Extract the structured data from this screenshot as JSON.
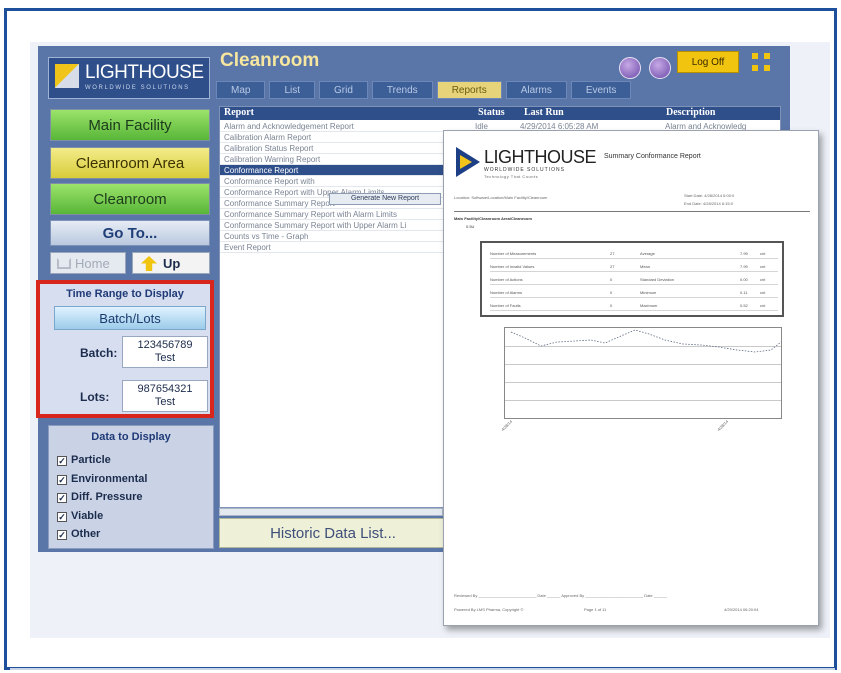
{
  "app": {
    "title": "Cleanroom",
    "logo_name": "LIGHTHOUSE",
    "logo_sub": "WORLDWIDE SOLUTIONS",
    "logoff_label": "Log Off"
  },
  "tabs": [
    {
      "label": "Map"
    },
    {
      "label": "List"
    },
    {
      "label": "Grid"
    },
    {
      "label": "Trends"
    },
    {
      "label": "Reports",
      "active": true
    },
    {
      "label": "Alarms"
    },
    {
      "label": "Events"
    }
  ],
  "nav": {
    "main_facility": "Main Facility",
    "cleanroom_area": "Cleanroom Area",
    "cleanroom": "Cleanroom",
    "goto": "Go To...",
    "home": "Home",
    "up": "Up"
  },
  "time_range": {
    "title": "Time Range to Display",
    "mode": "Batch/Lots",
    "batch_label": "Batch:",
    "batch_value_1": "123456789",
    "batch_value_2": "Test",
    "lots_label": "Lots:",
    "lots_value_1": "987654321",
    "lots_value_2": "Test"
  },
  "data_display": {
    "title": "Data to Display",
    "items": [
      {
        "label": "Particle",
        "checked": true
      },
      {
        "label": "Environmental",
        "checked": true
      },
      {
        "label": "Diff. Pressure",
        "checked": true
      },
      {
        "label": "Viable",
        "checked": true
      },
      {
        "label": "Other",
        "checked": true
      }
    ]
  },
  "report_list": {
    "headers": {
      "report": "Report",
      "status": "Status",
      "last_run": "Last Run",
      "description": "Description"
    },
    "rows": [
      {
        "name": "Alarm and Acknowledgement Report",
        "status": "Idle",
        "last_run": "4/29/2014 6:05:28 AM",
        "desc": "Alarm and Acknowledg"
      },
      {
        "name": "Calibration Alarm Report",
        "status": "",
        "last_run": "",
        "desc": ""
      },
      {
        "name": "Calibration Status Report",
        "status": "",
        "last_run": "",
        "desc": ""
      },
      {
        "name": "Calibration Warning Report",
        "status": "",
        "last_run": "",
        "desc": ""
      },
      {
        "name": "Conformance Report",
        "status": "",
        "last_run": "",
        "desc": "",
        "selected": true
      },
      {
        "name": "Conformance Report with",
        "status": "",
        "last_run": "",
        "desc": ""
      },
      {
        "name": "Conformance Report with Upper Alarm Limits",
        "status": "",
        "last_run": "",
        "desc": ""
      },
      {
        "name": "Conformance Summary Report",
        "status": "",
        "last_run": "",
        "desc": ""
      },
      {
        "name": "Conformance Summary Report with Alarm Limits",
        "status": "",
        "last_run": "",
        "desc": ""
      },
      {
        "name": "Conformance Summary Report with Upper Alarm Li",
        "status": "",
        "last_run": "",
        "desc": ""
      },
      {
        "name": "Counts vs Time - Graph",
        "status": "",
        "last_run": "",
        "desc": ""
      },
      {
        "name": "Event Report",
        "status": "",
        "last_run": "",
        "desc": ""
      }
    ],
    "generate_label": "Generate New Report",
    "historic_label": "Historic Data List..."
  },
  "summary_doc": {
    "logo_name": "LIGHTHOUSE",
    "logo_sub": "WORLDWIDE SOLUTIONS",
    "logo_tagline": "Technology That Counts",
    "title": "Summary Conformance Report",
    "location_label": "Location:",
    "location_value": "Software/Location/Main Facility/Cleanroom",
    "start_label": "Start Date:",
    "start_value": "4/28/2014 6:00:0",
    "end_label": "End Date:",
    "end_value": "4/28/2014 6:15:0",
    "section_label": "Main Facility/Cleanroom Area/Cleanroom",
    "section_sub": "0.5U",
    "stats": [
      {
        "label": "Number of Measurements",
        "count": "27",
        "stat": "Average",
        "value": "7.99",
        "unit": "cnt"
      },
      {
        "label": "Number of Invalid Values",
        "count": "27",
        "stat": "Mean",
        "value": "7.99",
        "unit": "cnt"
      },
      {
        "label": "Number of Actions",
        "count": "0",
        "stat": "Standard Deviation",
        "value": "0.00",
        "unit": "cnt"
      },
      {
        "label": "Number of Alarms",
        "count": "0",
        "stat": "Minimum",
        "value": "0.11",
        "unit": "cnt"
      },
      {
        "label": "Number of Faults",
        "count": "0",
        "stat": "Maximum",
        "value": "0.52",
        "unit": "cnt"
      }
    ],
    "reviewed_by": "Reviewed By",
    "date_label": "Date",
    "approved_by": "Approved By",
    "footer_left": "Powered By LMS Pharma, Copyright ©",
    "footer_page": "Page 1 of 11",
    "footer_date": "4/29/2014 06:20:04"
  },
  "colors": {
    "frame": "#1d4f9a",
    "highlight": "#d9261c",
    "tab_active": "#e7d47a",
    "logoff": "#f1c40f"
  }
}
